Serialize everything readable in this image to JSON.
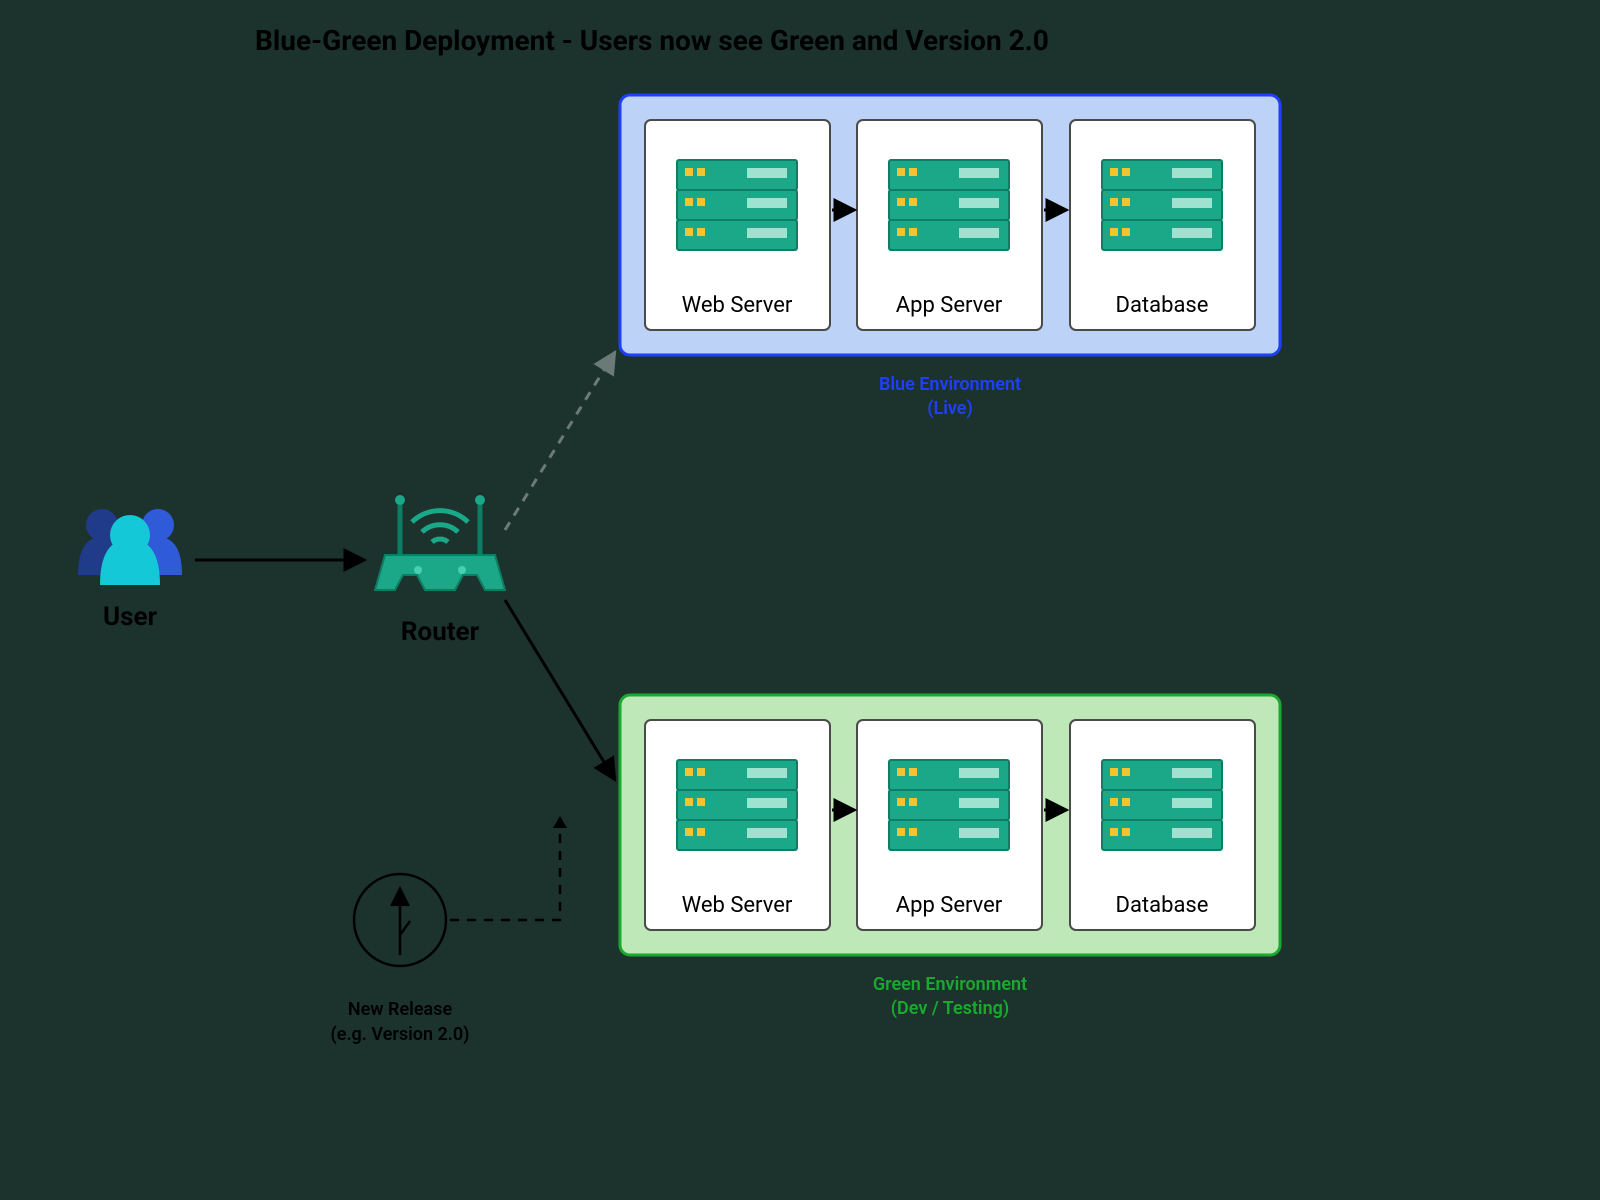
{
  "title": "Blue-Green Deployment - Users now see Green and Version 2.0",
  "user": {
    "label": "User"
  },
  "router": {
    "label": "Router"
  },
  "blue": {
    "label": "Blue Environment",
    "sub": "(Live)",
    "color": "#2a3bff",
    "boxes": {
      "web": "Web Server",
      "app": "App Server",
      "db": "Database"
    }
  },
  "green": {
    "label": "Green Environment",
    "sub": "(Dev / Testing)",
    "color": "#1aa82e",
    "boxes": {
      "web": "Web Server",
      "app": "App Server",
      "db": "Database"
    }
  },
  "release": {
    "l1": "New Release",
    "l2": "(e.g. Version 2.0)"
  },
  "colors": {
    "bg": "#1c332d",
    "blueFill": "#bcd2f7",
    "blueStroke": "#1f3fff",
    "greenFill": "#bfe8b8",
    "greenStroke": "#1aa82e",
    "cardFill": "#ffffff",
    "cardStroke": "#4a4a4a",
    "arrow": "#000000",
    "arrowDim": "#6b7a77"
  }
}
